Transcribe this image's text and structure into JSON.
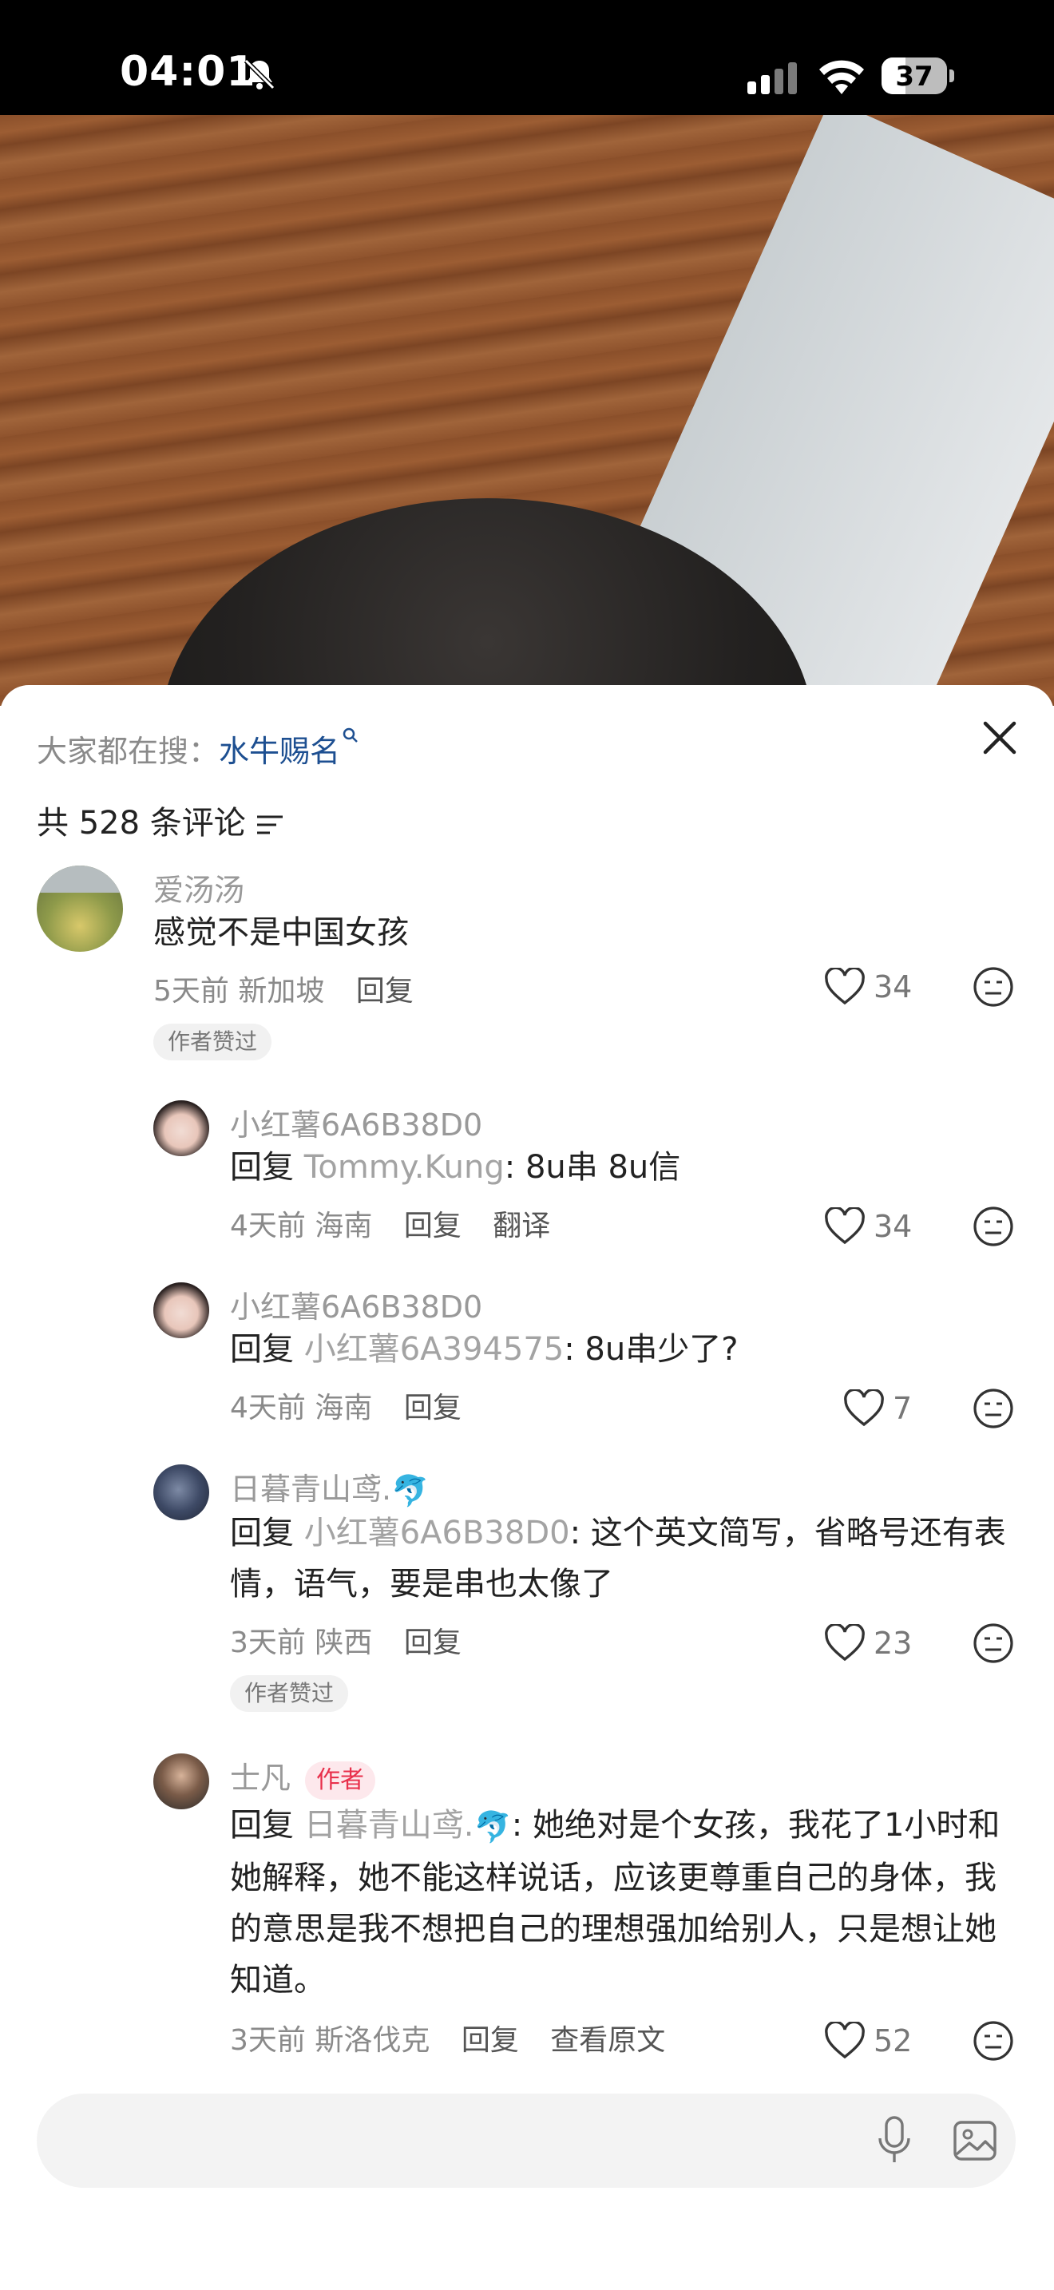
{
  "status_bar": {
    "time": "04:01",
    "battery_level": "37",
    "battery_fraction": 0.37,
    "icons": [
      "bell-slash-icon",
      "cellular-signal-icon",
      "wifi-icon",
      "battery-icon"
    ]
  },
  "sheet": {
    "search_prefix": "大家都在搜：",
    "search_keyword": "水牛赐名",
    "comment_count": "共 528 条评论",
    "icons": [
      "search-mini-icon",
      "close-icon",
      "sort-icon"
    ]
  },
  "comments": [
    {
      "user": "爱汤汤",
      "text": "感觉不是中国女孩",
      "time": "5天前",
      "location": "新加坡",
      "reply_label": "回复",
      "likes": "34",
      "tag": "作者赞过"
    },
    {
      "user": "小红薯6A6B38D0",
      "reply_prefix": "回复",
      "reply_to": "Tommy.Kung",
      "text": ": 8u串 8u信",
      "time": "4天前",
      "location": "海南",
      "reply_label": "回复",
      "translate_label": "翻译",
      "likes": "34"
    },
    {
      "user": "小红薯6A6B38D0",
      "reply_prefix": "回复",
      "reply_to": "小红薯6A394575",
      "text": ": 8u串少了?",
      "time": "4天前",
      "location": "海南",
      "reply_label": "回复",
      "likes": "7"
    },
    {
      "user": "日暮青山鸢.",
      "user_emoji": "🐬",
      "reply_prefix": "回复",
      "reply_to": "小红薯6A6B38D0",
      "text": ": 这个英文简写，省略号还有表情，语气，要是串也太像了",
      "time": "3天前",
      "location": "陕西",
      "reply_label": "回复",
      "likes": "23",
      "tag": "作者赞过"
    },
    {
      "user": "士凡",
      "author_badge": "作者",
      "reply_prefix": "回复",
      "reply_to": "日暮青山鸢.",
      "reply_to_emoji": "🐬",
      "text": ": 她绝对是个女孩，我花了1小时和她解释，她不能这样说话，应该更尊重自己的身体，我的意思是我不想把自己的理想强加给别人，只是想让她知道。",
      "time": "3天前",
      "location": "斯洛伐克",
      "reply_label": "回复",
      "original_label": "查看原文",
      "likes": "52"
    }
  ],
  "input_bar": {
    "placeholder": "",
    "icons": [
      "mic-icon",
      "image-icon"
    ]
  }
}
